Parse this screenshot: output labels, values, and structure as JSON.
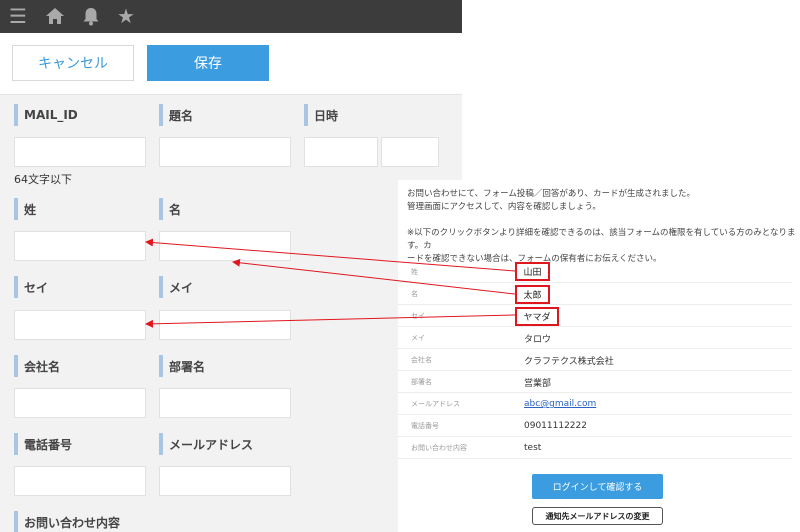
{
  "header": {
    "icons": [
      "menu-icon",
      "home-icon",
      "bell-icon",
      "star-icon"
    ]
  },
  "toolbar": {
    "cancel_label": "キャンセル",
    "save_label": "保存"
  },
  "form": {
    "mail_id_label": "MAIL_ID",
    "subject_label": "題名",
    "datetime_label": "日時",
    "mail_id_hint": "64文字以下",
    "last_name_label": "姓",
    "first_name_label": "名",
    "last_name_kana_label": "セイ",
    "first_name_kana_label": "メイ",
    "company_label": "会社名",
    "department_label": "部署名",
    "phone_label": "電話番号",
    "email_label": "メールアドレス",
    "inquiry_label": "お問い合わせ内容"
  },
  "email": {
    "intro_line1": "お問い合わせにて、フォーム投稿／回答があり、カードが生成されました。",
    "intro_line2": "管理画面にアクセスして、内容を確認しましょう。",
    "intro_line3": "※以下のクリックボタンより詳細を確認できるのは、該当フォームの権限を有している方のみとなります。カ",
    "intro_line4": "ードを確認できない場合は、フォームの保有者にお伝えください。",
    "fields": [
      {
        "key": "姓",
        "value": "山田"
      },
      {
        "key": "名",
        "value": "太郎"
      },
      {
        "key": "セイ",
        "value": "ヤマダ"
      },
      {
        "key": "メイ",
        "value": "タロウ"
      },
      {
        "key": "会社名",
        "value": "クラフテクス株式会社"
      },
      {
        "key": "部署名",
        "value": "営業部"
      },
      {
        "key": "メールアドレス",
        "value": "abc@gmail.com"
      },
      {
        "key": "電話番号",
        "value": "09011112222"
      },
      {
        "key": "お問い合わせ内容",
        "value": "test"
      }
    ],
    "login_button": "ログインして確認する",
    "change_button": "通知先メールアドレスの変更"
  },
  "colors": {
    "accent": "#3b9ce0",
    "highlight": "#e0161e",
    "label_bar": "#a8c5e3"
  }
}
